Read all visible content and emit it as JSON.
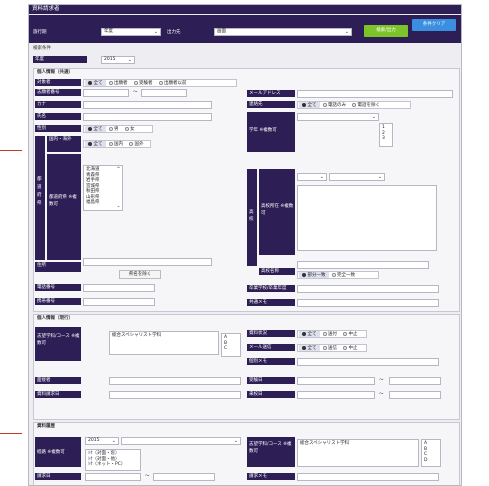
{
  "window_title": "資料請求者",
  "search_bar": {
    "label1": "旅行期",
    "sel1": "年度",
    "label2": "出力先",
    "sel2": "画面",
    "search_btn": "検索/出力",
    "clear_btn": "条件クリア"
  },
  "conditions": {
    "title": "検索条件",
    "year_label": "年度",
    "year_value": "2015"
  },
  "personal": {
    "title": "個人情報（共通）",
    "target_label": "対象者",
    "target_opts": [
      "全て",
      "出願者",
      "受験者",
      "出願者以前"
    ],
    "apply_label": "志願者番号",
    "range_sep": "～",
    "kana_label": "カナ",
    "name_label": "氏名",
    "gender_label": "性別",
    "gender_opts": [
      "全て",
      "男",
      "女"
    ],
    "pref_group": "都道府県",
    "domestic_label": "国内・海外",
    "domestic_opts": [
      "全て",
      "国内",
      "国外"
    ],
    "pref_label": "都道府県 ※複数可",
    "prefs": [
      "北海道",
      "青森県",
      "岩手県",
      "宮城県",
      "秋田県",
      "山形県",
      "福島県"
    ],
    "address_label": "住所",
    "prefix_btn": "県名を除く",
    "phone_label": "電話番号",
    "mobile_label": "携帯番号",
    "email_label": "メールアドレス",
    "contact_label": "連絡先",
    "contact_opts": [
      "全て",
      "電話のみ",
      "電話を除く"
    ],
    "school_grade_label": "学年 ※複数可",
    "grades": [
      "1",
      "2",
      "3"
    ],
    "school_group": "高校",
    "school_pref_label": "高校所在 ※複数可",
    "school_name_label": "高校名称",
    "school_name_opts": [
      "部分一致",
      "完全一致"
    ],
    "highschool_label": "卒業学校/卒業年度",
    "common_memo_label": "共通メモ"
  },
  "personal2": {
    "title": "個人情報（現行）",
    "dept_label": "志望学科/コース ※複数可",
    "dept_value": "総合スペシャリスト学科",
    "abc": [
      "A",
      "B",
      "C"
    ],
    "doc_label": "資料状況",
    "doc_opts": [
      "全て",
      "送付",
      "中止"
    ],
    "mail_label": "メール送信",
    "mail_opts": [
      "全て",
      "送信",
      "中止"
    ],
    "personal_memo_label": "個別メモ",
    "consult_label": "面接者",
    "examine_label": "受験日",
    "request_label": "資料請求日",
    "reg_label": "来校日"
  },
  "history": {
    "title": "資料履歴",
    "year_value": "2015",
    "route_label": "経路 ※複数可",
    "routes": [
      "ｼｸ（対面・窓）",
      "ｼｸ（対面・他）",
      "ｼｸ（ネット・PC）"
    ],
    "dept_label": "志望学科/コース ※複数可",
    "dept_value": "総合スペシャリスト学科",
    "abcd": [
      "A",
      "B",
      "C",
      "D"
    ],
    "date_label": "請求日",
    "memo_label": "請求メモ"
  },
  "colors": {
    "header": "#2d1f55",
    "accent_green": "#7cc42a",
    "accent_blue": "#3a8fe0"
  }
}
